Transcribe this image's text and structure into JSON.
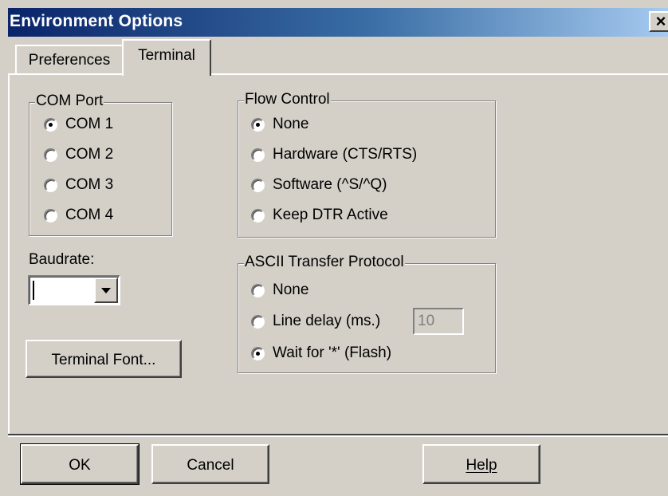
{
  "window": {
    "title": "Environment Options",
    "close_label": "×"
  },
  "tabs": [
    {
      "label": "Preferences",
      "active": false
    },
    {
      "label": "Terminal",
      "active": true
    }
  ],
  "com_port": {
    "legend": "COM Port",
    "options": [
      {
        "label": "COM 1",
        "checked": true
      },
      {
        "label": "COM 2",
        "checked": false
      },
      {
        "label": "COM 3",
        "checked": false
      },
      {
        "label": "COM 4",
        "checked": false
      }
    ]
  },
  "flow_control": {
    "legend": "Flow Control",
    "options": [
      {
        "label": "None",
        "checked": true
      },
      {
        "label": "Hardware (CTS/RTS)",
        "checked": false
      },
      {
        "label": "Software (^S/^Q)",
        "checked": false
      },
      {
        "label": "Keep DTR Active",
        "checked": false
      }
    ]
  },
  "baudrate": {
    "label": "Baudrate:",
    "value": ""
  },
  "ascii_protocol": {
    "legend": "ASCII Transfer Protocol",
    "options": [
      {
        "label": "None",
        "checked": false
      },
      {
        "label": "Line delay (ms.)",
        "checked": false
      },
      {
        "label": "Wait for '*' (Flash)",
        "checked": true
      }
    ],
    "line_delay_value": "10"
  },
  "buttons": {
    "terminal_font": "Terminal Font...",
    "ok": "OK",
    "cancel": "Cancel",
    "help": "Help"
  },
  "colors": {
    "title_start": "#0a246a",
    "title_end": "#a6caf0",
    "face": "#d4d0c8"
  }
}
